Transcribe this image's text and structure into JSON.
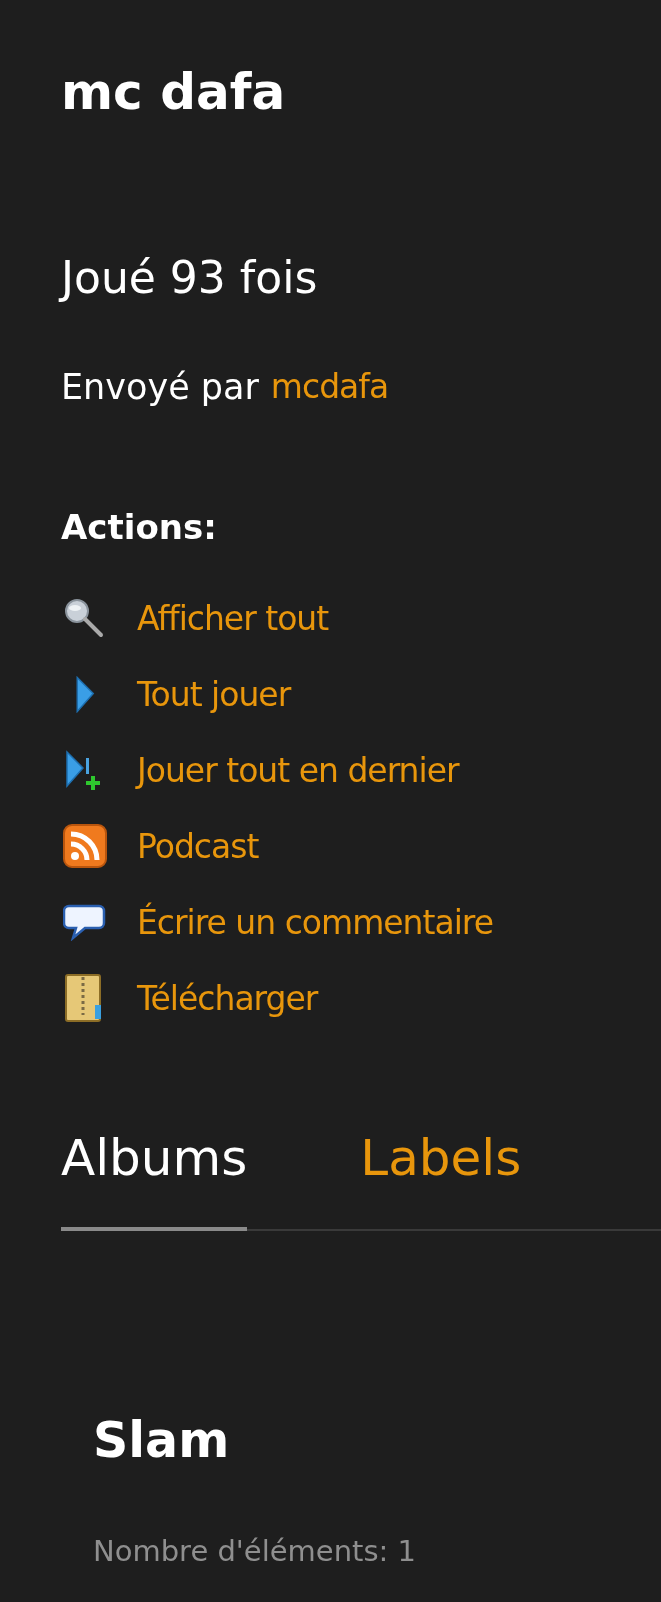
{
  "title": "mc dafa",
  "play_count": "Joué 93 fois",
  "uploaded_by": {
    "label": "Envoyé par",
    "user": "mcdafa"
  },
  "actions_heading": "Actions:",
  "actions": [
    {
      "kind": "search",
      "label": "Afficher tout"
    },
    {
      "kind": "play",
      "label": "Tout jouer"
    },
    {
      "kind": "enqueue",
      "label": "Jouer tout en dernier"
    },
    {
      "kind": "rss",
      "label": "Podcast"
    },
    {
      "kind": "comment",
      "label": "Écrire un commentaire"
    },
    {
      "kind": "download",
      "label": "Télécharger"
    }
  ],
  "tabs": [
    {
      "label": "Albums",
      "selected": true
    },
    {
      "label": "Labels",
      "selected": false
    }
  ],
  "albums": [
    {
      "title": "Slam",
      "count": "Nombre d'éléments: 1"
    }
  ]
}
